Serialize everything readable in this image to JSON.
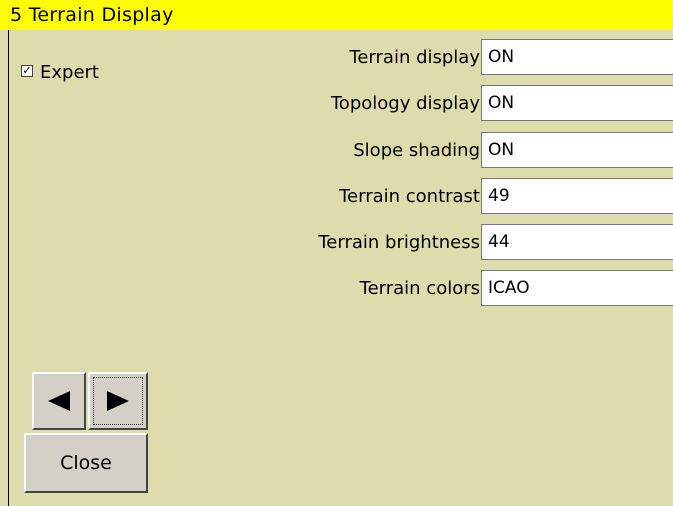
{
  "title": "5 Terrain Display",
  "expert": {
    "label": "Expert",
    "checked": true,
    "check_glyph": "☑"
  },
  "settings": [
    {
      "label": "Terrain display",
      "value": "ON"
    },
    {
      "label": "Topology display",
      "value": "ON"
    },
    {
      "label": "Slope shading",
      "value": "ON"
    },
    {
      "label": "Terrain contrast",
      "value": "49"
    },
    {
      "label": "Terrain brightness",
      "value": "44"
    },
    {
      "label": "Terrain colors",
      "value": "ICAO"
    }
  ],
  "buttons": {
    "close": "Close",
    "prev_icon": "arrow-left-icon",
    "next_icon": "arrow-right-icon"
  },
  "colors": {
    "background": "#dcdcac",
    "titlebar": "#ffff00"
  }
}
